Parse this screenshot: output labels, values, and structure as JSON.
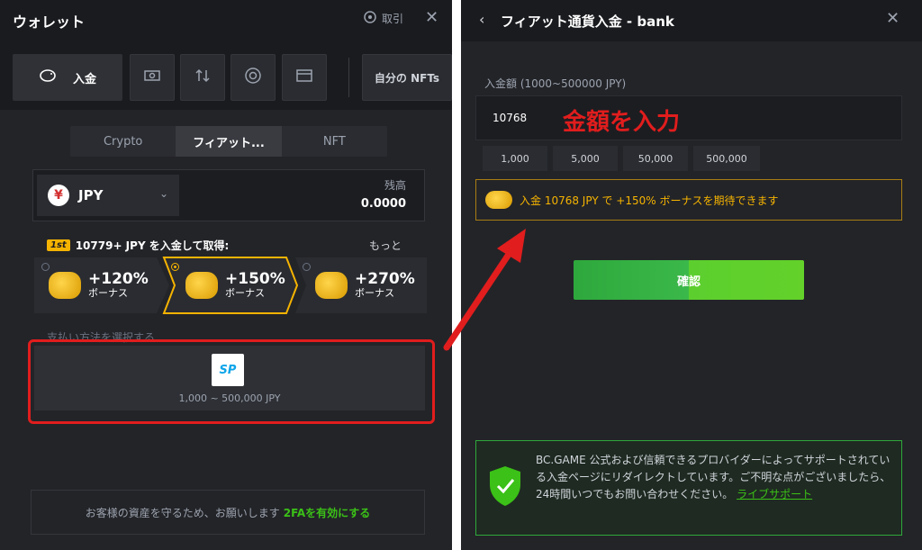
{
  "left": {
    "title": "ウォレット",
    "history_label": "取引",
    "toolbar": {
      "deposit_label": "入金",
      "my_nfts_label": "自分の NFTs"
    },
    "tabs": [
      "Crypto",
      "フィアット...",
      "NFT"
    ],
    "currency": {
      "code": "JPY",
      "symbol": "¥",
      "balance_label": "残高",
      "balance_value": "0.0000"
    },
    "promo": {
      "badge": "1st",
      "text": "10779+ JPY を入金して取得:",
      "more": "もっと"
    },
    "bonuses": [
      {
        "percent": "+120%",
        "label": "ボーナス",
        "selected": false
      },
      {
        "percent": "+150%",
        "label": "ボーナス",
        "selected": true
      },
      {
        "percent": "+270%",
        "label": "ボーナス",
        "selected": false
      }
    ],
    "payment": {
      "label": "支払い方法を選択する",
      "logo_text": "SP",
      "range": "1,000 ~ 500,000 JPY"
    },
    "twofa": {
      "text": "お客様の資産を守るため、お願いします",
      "link": "2FAを有効にする"
    }
  },
  "right": {
    "title": "フィアット通貨入金 - bank",
    "amount_label": "入金額 (1000~500000 JPY)",
    "amount_value": "10768",
    "annotation": "金額を入力",
    "quick_amounts": [
      "1,000",
      "5,000",
      "50,000",
      "500,000"
    ],
    "bonus_note": "入金 10768 JPY で +150% ボーナスを期待できます",
    "confirm_label": "確認",
    "secure_text": "BC.GAME 公式および信頼できるプロバイダーによってサポートされている入金ページにリダイレクトしています。ご不明な点がございましたら、24時間いつでもお問い合わせください。",
    "support_link": "ライブサポート"
  },
  "colors": {
    "accent_green": "#3bc117",
    "bonus_gold": "#f5b301",
    "highlight_red": "#e11d1d"
  }
}
